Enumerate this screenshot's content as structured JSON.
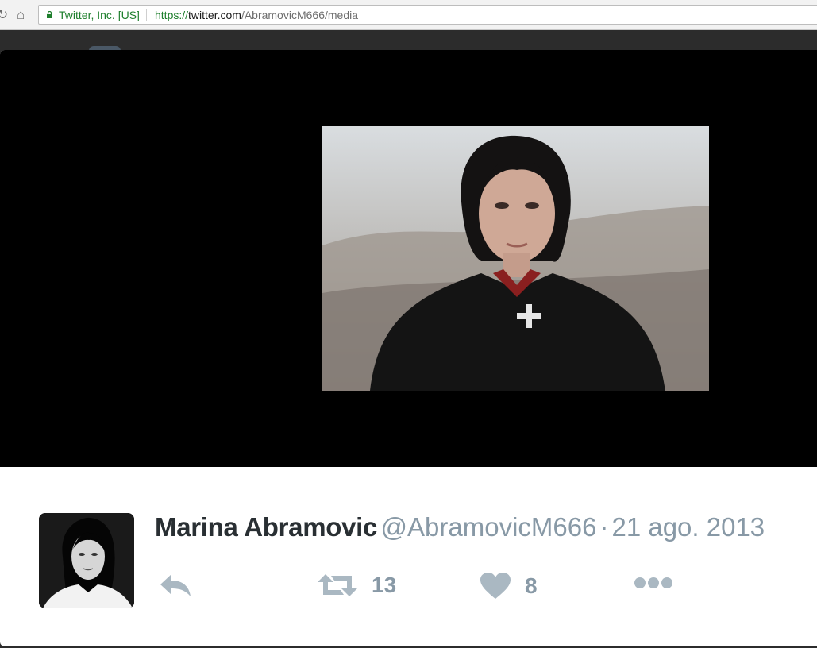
{
  "browser": {
    "site_identity": "Twitter, Inc. [US]",
    "url_protocol": "https://",
    "url_host": "twitter.com",
    "url_path": "/AbramovicM666/media"
  },
  "tweet": {
    "author_name": "Marina Abramovic",
    "author_handle": "@AbramovicM666",
    "separator": "·",
    "date": "21 ago. 2013",
    "retweet_count": "13",
    "like_count": "8"
  },
  "icons": {
    "reply": "reply-icon",
    "retweet": "retweet-icon",
    "like": "heart-icon",
    "more": "more-icon"
  },
  "colors": {
    "name": "#292f33",
    "muted": "#8899a6",
    "secure": "#1e7f2d",
    "stage": "#000000"
  }
}
